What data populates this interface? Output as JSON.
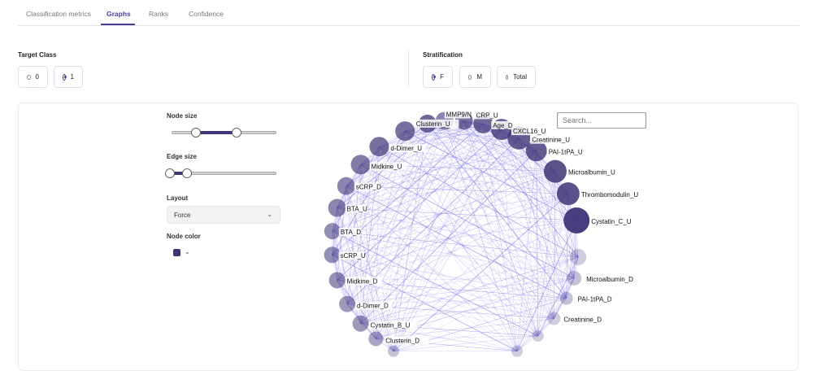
{
  "tabs": [
    "Classification metrics",
    "Graphs",
    "Ranks",
    "Confidence"
  ],
  "target_class": {
    "title": "Target Class",
    "options": [
      "0",
      "1"
    ],
    "selected": "1"
  },
  "stratification": {
    "title": "Stratification",
    "options": [
      "F",
      "M",
      "Total"
    ],
    "selected": "F"
  },
  "controls": {
    "node_size_label": "Node size",
    "edge_size_label": "Edge size",
    "layout_label": "Layout",
    "layout_value": "Force",
    "node_color_label": "Node color",
    "node_color": "#3d3576"
  },
  "search": {
    "placeholder": "Search..."
  },
  "graph": {
    "edge_color": "#6a5fe0",
    "labels": [
      "Clusterin_U",
      "MMP9/N",
      "CRP_U",
      "Age_D",
      "CXCL16_U",
      "Creatinine_U",
      "PAI-1tPA_U",
      "Microalbumin_U",
      "Thrombomodulin_U",
      "Cystatin_C_U",
      "d-Dimer_U",
      "Midkine_U",
      "sCRP_D",
      "BTA_U",
      "BTA_D",
      "sCRP_U",
      "Midkine_D",
      "d-Dimer_D",
      "Cystatin_B_U",
      "Clusterin_D",
      "Microalbumin_D",
      "PAI-1tPA_D",
      "Creatinine_D"
    ]
  }
}
